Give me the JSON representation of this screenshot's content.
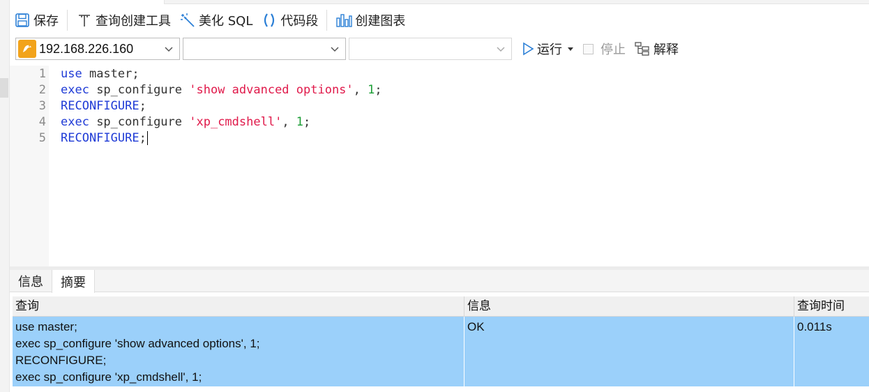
{
  "toolbar": {
    "save_label": "保存",
    "query_builder_label": "查询创建工具",
    "beautify_label": "美化 SQL",
    "snippet_label": "代码段",
    "create_chart_label": "创建图表"
  },
  "connection_bar": {
    "connection_value": "192.168.226.160",
    "database_value": "",
    "schema_value": "",
    "run_label": "运行",
    "stop_label": "停止",
    "explain_label": "解释"
  },
  "editor": {
    "line_numbers": [
      "1",
      "2",
      "3",
      "4",
      "5"
    ],
    "lines": [
      {
        "kw": "use",
        "rest": " master;"
      },
      {
        "kw": "exec",
        "mid": " sp_configure ",
        "str": "'show advanced options'",
        "sep": ", ",
        "num": "1",
        "end": ";"
      },
      {
        "kw": "RECONFIGURE",
        "rest": ";"
      },
      {
        "kw": "exec",
        "mid": " sp_configure ",
        "str": "'xp_cmdshell'",
        "sep": ", ",
        "num": "1",
        "end": ";"
      },
      {
        "kw": "RECONFIGURE",
        "rest": ";"
      }
    ]
  },
  "result_tabs": [
    "信息",
    "摘要"
  ],
  "result_grid": {
    "columns": [
      "查询",
      "信息",
      "查询时间"
    ],
    "rows": [
      {
        "query_lines": [
          "use master;",
          "exec sp_configure 'show advanced options', 1;",
          "RECONFIGURE;",
          "exec sp_configure 'xp_cmdshell', 1;"
        ],
        "message": "OK",
        "time": "0.011s"
      }
    ]
  },
  "colors": {
    "keyword": "#1f3bd6",
    "string": "#e0194a",
    "number": "#1a9d34",
    "selected_row": "#9bd0fa",
    "icon_blue": "#2b7fd6",
    "connection_icon": "#f2a31b"
  }
}
